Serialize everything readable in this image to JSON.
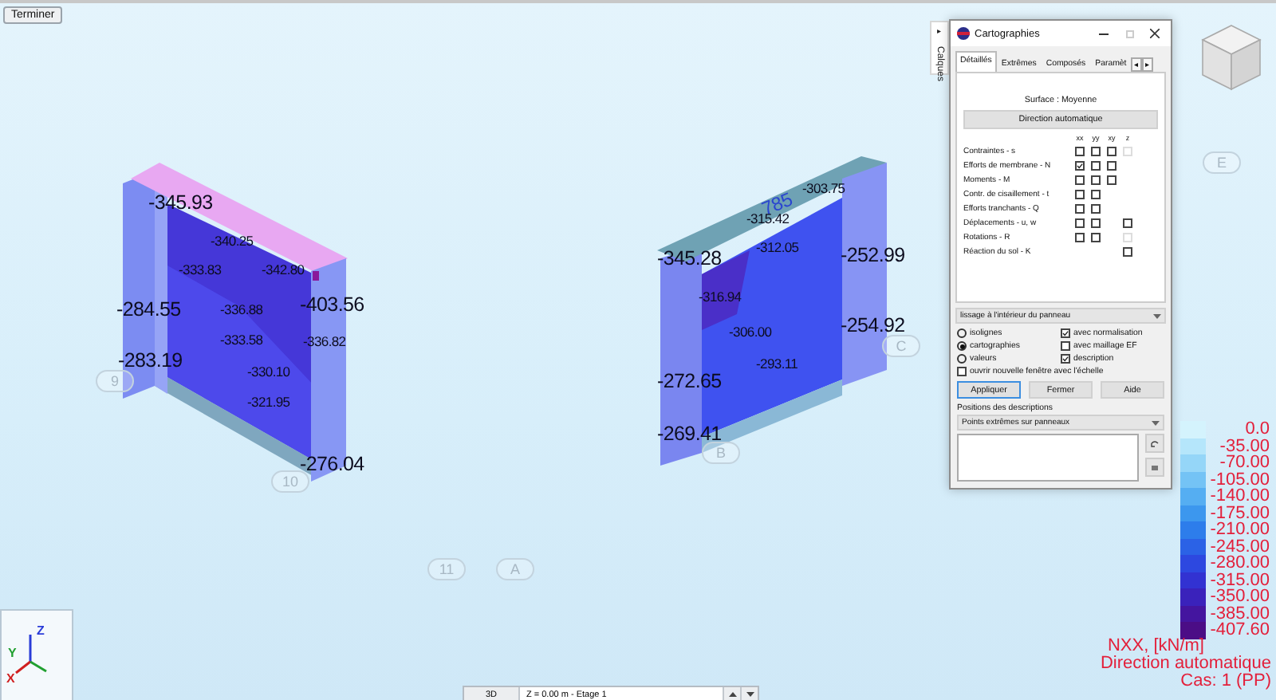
{
  "toolbar": {
    "finish_button": "Terminer"
  },
  "side_tab": {
    "label": "Calques",
    "arrow": "▸"
  },
  "viewport": {
    "labels": [
      {
        "text": "-345.93",
        "kind": "large"
      },
      {
        "text": "-340.25",
        "kind": "small"
      },
      {
        "text": "-333.83",
        "kind": "small"
      },
      {
        "text": "-342.80",
        "kind": "small"
      },
      {
        "text": "-284.55",
        "kind": "large"
      },
      {
        "text": "-336.88",
        "kind": "small"
      },
      {
        "text": "-403.56",
        "kind": "large"
      },
      {
        "text": "-333.58",
        "kind": "small"
      },
      {
        "text": "-336.82",
        "kind": "small"
      },
      {
        "text": "-283.19",
        "kind": "large"
      },
      {
        "text": "-330.10",
        "kind": "small"
      },
      {
        "text": "-321.95",
        "kind": "small"
      },
      {
        "text": "-276.04",
        "kind": "large"
      },
      {
        "text": "785",
        "kind": "dimension"
      },
      {
        "text": "-303.75",
        "kind": "small"
      },
      {
        "text": "-315.42",
        "kind": "small"
      },
      {
        "text": "-312.05",
        "kind": "small"
      },
      {
        "text": "-345.28",
        "kind": "large"
      },
      {
        "text": "-252.99",
        "kind": "large"
      },
      {
        "text": "-316.94",
        "kind": "small"
      },
      {
        "text": "-306.00",
        "kind": "small"
      },
      {
        "text": "-254.92",
        "kind": "large"
      },
      {
        "text": "-293.11",
        "kind": "small"
      },
      {
        "text": "-272.65",
        "kind": "large"
      },
      {
        "text": "-269.41",
        "kind": "large"
      }
    ],
    "grid_markers": [
      "9",
      "10",
      "11",
      "A",
      "B",
      "C",
      "E"
    ],
    "axes": {
      "x": "X",
      "y": "Y",
      "z": "Z"
    }
  },
  "dialog": {
    "title": "Cartographies",
    "tabs": [
      {
        "label": "Détaillés",
        "selected": true
      },
      {
        "label": "Extrêmes",
        "selected": false
      },
      {
        "label": "Composés",
        "selected": false
      },
      {
        "label": "Paramèt",
        "selected": false
      }
    ],
    "tab_scroll": [
      "◂",
      "▸"
    ],
    "surface": "Surface : Moyenne",
    "direction_button": "Direction automatique",
    "columns": [
      "xx",
      "yy",
      "xy",
      "z"
    ],
    "rows": [
      {
        "label": "Contraintes - s",
        "boxes": [
          {
            "kind": "box",
            "checked": false,
            "disabled": false
          },
          {
            "kind": "box",
            "checked": false,
            "disabled": false
          },
          {
            "kind": "box",
            "checked": false,
            "disabled": false
          },
          {
            "kind": "box",
            "checked": false,
            "disabled": true
          }
        ]
      },
      {
        "label": "Efforts de membrane - N",
        "boxes": [
          {
            "kind": "box",
            "checked": true,
            "disabled": false
          },
          {
            "kind": "box",
            "checked": false,
            "disabled": false
          },
          {
            "kind": "box",
            "checked": false,
            "disabled": false
          },
          {
            "kind": "empty"
          }
        ]
      },
      {
        "label": "Moments - M",
        "boxes": [
          {
            "kind": "box",
            "checked": false,
            "disabled": false
          },
          {
            "kind": "box",
            "checked": false,
            "disabled": false
          },
          {
            "kind": "box",
            "checked": false,
            "disabled": false
          },
          {
            "kind": "empty"
          }
        ]
      },
      {
        "label": "Contr. de cisaillement - t",
        "boxes": [
          {
            "kind": "box",
            "checked": false,
            "disabled": false
          },
          {
            "kind": "box",
            "checked": false,
            "disabled": false
          },
          {
            "kind": "empty"
          },
          {
            "kind": "empty"
          }
        ]
      },
      {
        "label": "Efforts tranchants - Q",
        "boxes": [
          {
            "kind": "box",
            "checked": false,
            "disabled": false
          },
          {
            "kind": "box",
            "checked": false,
            "disabled": false
          },
          {
            "kind": "empty"
          },
          {
            "kind": "empty"
          }
        ]
      },
      {
        "label": "Déplacements - u, w",
        "boxes": [
          {
            "kind": "box",
            "checked": false,
            "disabled": false
          },
          {
            "kind": "box",
            "checked": false,
            "disabled": false
          },
          {
            "kind": "empty"
          },
          {
            "kind": "box",
            "checked": false,
            "disabled": false
          }
        ]
      },
      {
        "label": "Rotations - R",
        "boxes": [
          {
            "kind": "box",
            "checked": false,
            "disabled": false
          },
          {
            "kind": "box",
            "checked": false,
            "disabled": false
          },
          {
            "kind": "empty"
          },
          {
            "kind": "box",
            "checked": false,
            "disabled": true
          }
        ]
      },
      {
        "label": "Réaction du sol - K",
        "boxes": [
          {
            "kind": "empty"
          },
          {
            "kind": "empty"
          },
          {
            "kind": "empty"
          },
          {
            "kind": "box",
            "checked": false,
            "disabled": false
          }
        ]
      }
    ],
    "smoothing": "lissage à l'intérieur du panneau",
    "modes": [
      {
        "label": "isolignes",
        "selected": false
      },
      {
        "label": "cartographies",
        "selected": true
      },
      {
        "label": "valeurs",
        "selected": false
      }
    ],
    "options": [
      {
        "label": "avec normalisation",
        "checked": true
      },
      {
        "label": "avec maillage EF",
        "checked": false
      },
      {
        "label": "description",
        "checked": true
      }
    ],
    "new_window": {
      "label": "ouvrir nouvelle fenêtre avec l'échelle",
      "checked": false
    },
    "buttons": [
      "Appliquer",
      "Fermer",
      "Aide"
    ],
    "positions_label": "Positions des descriptions",
    "positions_value": "Points extrêmes sur panneaux"
  },
  "legend": {
    "entries": [
      {
        "label": "0.0",
        "color": "#d4f3fd"
      },
      {
        "label": "-35.00",
        "color": "#b5e6fb"
      },
      {
        "label": "-70.00",
        "color": "#95d6f8"
      },
      {
        "label": "-105.00",
        "color": "#74c3f5"
      },
      {
        "label": "-140.00",
        "color": "#55aef2"
      },
      {
        "label": "-175.00",
        "color": "#3c97ee"
      },
      {
        "label": "-210.00",
        "color": "#2d7deb"
      },
      {
        "label": "-245.00",
        "color": "#2b62e6"
      },
      {
        "label": "-280.00",
        "color": "#2d48e0"
      },
      {
        "label": "-315.00",
        "color": "#3232d2"
      },
      {
        "label": "-350.00",
        "color": "#3a22bb"
      },
      {
        "label": "-385.00",
        "color": "#44159f"
      },
      {
        "label": "-407.60",
        "color": "#4b0d86"
      }
    ],
    "quantity": "NXX, [kN/m]",
    "direction": "Direction automatique",
    "case": "Cas: 1 (PP)"
  },
  "status_bar": {
    "view": "3D",
    "level": "Z = 0.00 m - Etage 1"
  }
}
